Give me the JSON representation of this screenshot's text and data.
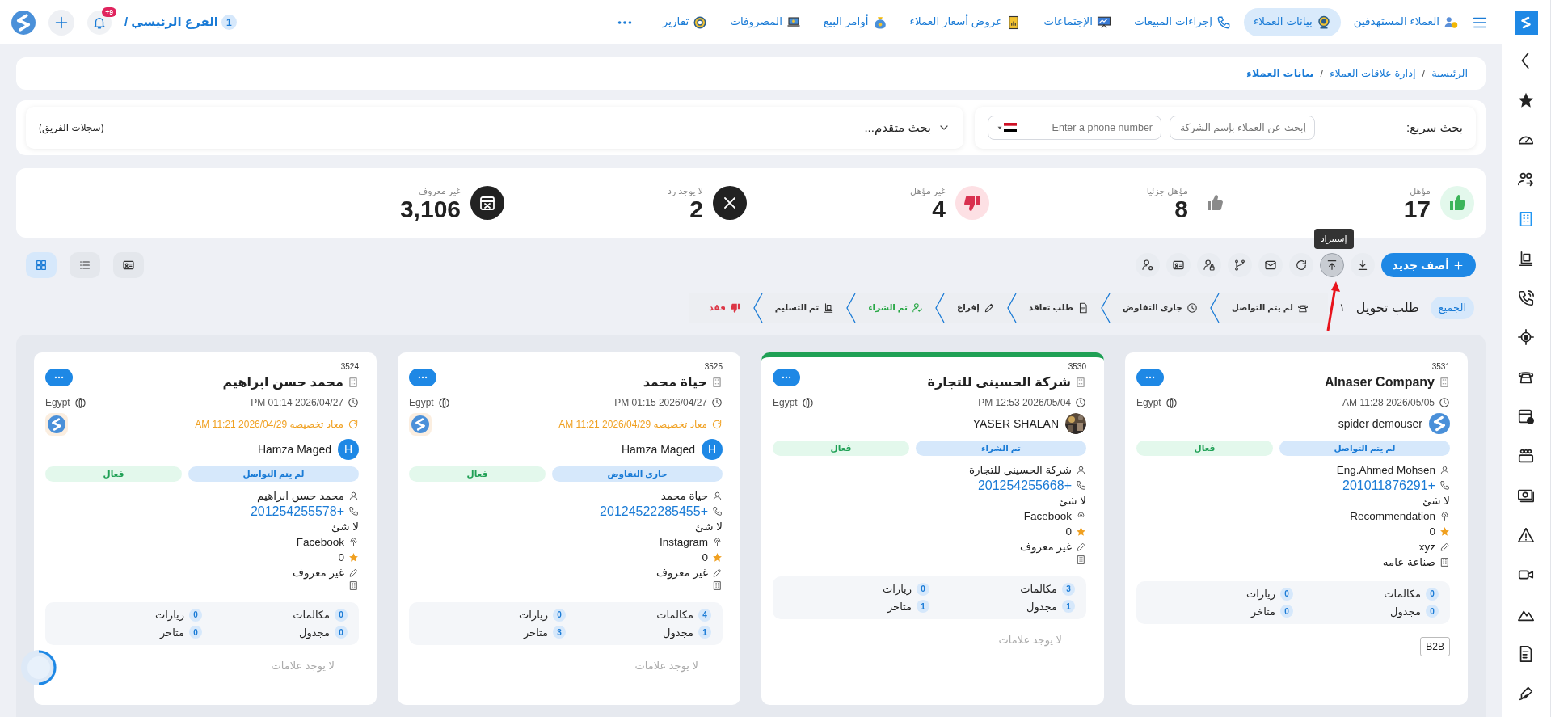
{
  "top_nav": {
    "items": [
      {
        "label": "العملاء المستهدفين",
        "selected": false
      },
      {
        "label": "بيانات العملاء",
        "selected": true
      },
      {
        "label": "إجراءات المبيعات",
        "selected": false
      },
      {
        "label": "الإجتماعات",
        "selected": false
      },
      {
        "label": "عروض أسعار العملاء",
        "selected": false
      },
      {
        "label": "أوامر البيع",
        "selected": false
      },
      {
        "label": "المصروفات",
        "selected": false
      },
      {
        "label": "تقارير",
        "selected": false
      }
    ],
    "branch_count": "1",
    "branch": "الفرع الرئيسي /",
    "notification_badge": "9+"
  },
  "sidebar": {
    "items": [
      {
        "selected": false
      },
      {
        "selected": false
      },
      {
        "selected": false
      },
      {
        "selected": true
      },
      {
        "selected": false
      },
      {
        "selected": false
      },
      {
        "selected": false
      },
      {
        "selected": false
      },
      {
        "selected": false
      },
      {
        "selected": false
      },
      {
        "selected": false
      },
      {
        "selected": false
      },
      {
        "selected": false
      },
      {
        "selected": false
      },
      {
        "selected": false
      },
      {
        "selected": false
      }
    ]
  },
  "breadcrumb": [
    {
      "label": "الرئيسية",
      "current": false,
      "separator": "/"
    },
    {
      "label": "إدارة علاقات العملاء",
      "current": false,
      "separator": "/"
    },
    {
      "label": "بيانات العملاء",
      "current": true
    }
  ],
  "search": {
    "label": "بحث سريع:",
    "company_placeholder": "إبحث عن العملاء بإسم الشركة",
    "phone_placeholder": "Enter a phone number",
    "advanced": "بحث متقدم...",
    "team_records": "(سجلات الفريق)"
  },
  "stats": [
    {
      "kind": "qualified",
      "label": "مؤهل",
      "value": "17"
    },
    {
      "kind": "partial",
      "label": "مؤهل جزئيا",
      "value": "8"
    },
    {
      "kind": "unqualified",
      "label": "غير مؤهل",
      "value": "4"
    },
    {
      "kind": "no_reply",
      "label": "لا يوجد رد",
      "value": "2"
    },
    {
      "kind": "unknown",
      "label": "غير معروف",
      "value": "3,106"
    }
  ],
  "toolbar": {
    "add_label": "أضف جديد",
    "tooltip": "إستيراد",
    "actions": [
      {
        "hovered": false
      },
      {
        "hovered": true
      },
      {
        "hovered": false
      },
      {
        "hovered": false
      },
      {
        "hovered": false
      },
      {
        "hovered": false
      },
      {
        "hovered": false
      },
      {
        "hovered": false
      }
    ],
    "views": [
      {
        "selected": false
      },
      {
        "selected": false
      },
      {
        "selected": true
      }
    ]
  },
  "pipeline": {
    "all_label": "الجميع",
    "all_selected": true,
    "transfer_label": "طلب تحويل",
    "transfer_count": "١",
    "stages": [
      {
        "label": "لم يتم التواصل",
        "color": "#333333"
      },
      {
        "label": "جارى التفاوض",
        "color": "#333333"
      },
      {
        "label": "طلب تعاقد",
        "color": "#333333"
      },
      {
        "label": "إفراغ",
        "color": "#333333"
      },
      {
        "label": "تم الشراء",
        "color": "#28a745"
      },
      {
        "label": "تم التسليم",
        "color": "#333333"
      },
      {
        "label": "فقد",
        "color": "#dc3545"
      }
    ]
  },
  "cards": [
    {
      "id": "3531",
      "name": "Alnaser Company",
      "highlighted": false,
      "date": "2026/05/05 11:28 AM",
      "country": "Egypt",
      "assignee": {
        "name": "spider demouser",
        "kind": "logo"
      },
      "stage": "لم يتم التواصل",
      "status": "فعال",
      "fields": [
        {
          "kind": "contact",
          "text": "Eng.Ahmed Mohsen"
        },
        {
          "kind": "phone",
          "text": "+201011876291"
        },
        {
          "kind": "notes",
          "text": "لا شئ"
        },
        {
          "kind": "source",
          "text": "Recommendation"
        },
        {
          "kind": "rating",
          "text": "0"
        },
        {
          "kind": "product",
          "text": "xyz"
        },
        {
          "kind": "industry",
          "text": "صناعة عامه"
        }
      ],
      "counters": [
        {
          "label": "مكالمات",
          "value": "0"
        },
        {
          "label": "زيارات",
          "value": "0"
        },
        {
          "label": "مجدول",
          "value": "0"
        },
        {
          "label": "متاخر",
          "value": "0"
        }
      ],
      "tags": [
        "B2B"
      ]
    },
    {
      "id": "3530",
      "name": "شركة الحسينى للتجارة",
      "highlighted": true,
      "date": "2026/05/04 12:53 PM",
      "country": "Egypt",
      "assignee": {
        "name": "YASER SHALAN"
      },
      "stage": "تم الشراء",
      "status": "فعال",
      "fields": [
        {
          "kind": "contact",
          "text": "شركة الحسينى للتجارة"
        },
        {
          "kind": "phone",
          "text": "+201254255668"
        },
        {
          "kind": "notes",
          "text": "لا شئ"
        },
        {
          "kind": "source",
          "text": "Facebook"
        },
        {
          "kind": "rating",
          "text": "0"
        },
        {
          "kind": "product",
          "text": "غير معروف"
        },
        {
          "kind": "industry"
        }
      ],
      "counters": [
        {
          "label": "مكالمات",
          "value": "3"
        },
        {
          "label": "زيارات",
          "value": "0"
        },
        {
          "label": "مجدول",
          "value": "1"
        },
        {
          "label": "متاخر",
          "value": "1"
        }
      ],
      "no_tags": "لا يوجد علامات"
    },
    {
      "id": "3525",
      "name": "حياة محمد",
      "highlighted": false,
      "date": "2026/04/27 01:15 PM",
      "country": "Egypt",
      "reassigned": "معاد تخصيصه 2026/04/29 11:21 AM",
      "assignee": {
        "name": "Hamza Maged",
        "kind": "letter",
        "initial": "H"
      },
      "stage": "جارى التفاوض",
      "status": "فعال",
      "fields": [
        {
          "kind": "contact",
          "text": "حياة محمد"
        },
        {
          "kind": "phone",
          "text": "+20124522285455"
        },
        {
          "kind": "notes",
          "text": "لا شئ"
        },
        {
          "kind": "source",
          "text": "Instagram"
        },
        {
          "kind": "rating",
          "text": "0"
        },
        {
          "kind": "product",
          "text": "غير معروف"
        },
        {
          "kind": "industry"
        }
      ],
      "counters": [
        {
          "label": "مكالمات",
          "value": "4"
        },
        {
          "label": "زيارات",
          "value": "0"
        },
        {
          "label": "مجدول",
          "value": "1"
        },
        {
          "label": "متاخر",
          "value": "3"
        }
      ],
      "no_tags": "لا يوجد علامات"
    },
    {
      "id": "3524",
      "name": "محمد حسن ابراهيم",
      "highlighted": false,
      "date": "2026/04/27 01:14 PM",
      "country": "Egypt",
      "reassigned": "معاد تخصيصه 2026/04/29 11:21 AM",
      "assignee": {
        "name": "Hamza Maged",
        "kind": "letter",
        "initial": "H"
      },
      "stage": "لم يتم التواصل",
      "status": "فعال",
      "fields": [
        {
          "kind": "contact",
          "text": "محمد حسن ابراهيم"
        },
        {
          "kind": "phone",
          "text": "+201254255578"
        },
        {
          "kind": "notes",
          "text": "لا شئ"
        },
        {
          "kind": "source",
          "text": "Facebook"
        },
        {
          "kind": "rating",
          "text": "0"
        },
        {
          "kind": "product",
          "text": "غير معروف"
        },
        {
          "kind": "industry"
        }
      ],
      "counters": [
        {
          "label": "مكالمات",
          "value": "0"
        },
        {
          "label": "زيارات",
          "value": "0"
        },
        {
          "label": "مجدول",
          "value": "0"
        },
        {
          "label": "متاخر",
          "value": "0"
        }
      ],
      "no_tags": "لا يوجد علامات"
    }
  ]
}
